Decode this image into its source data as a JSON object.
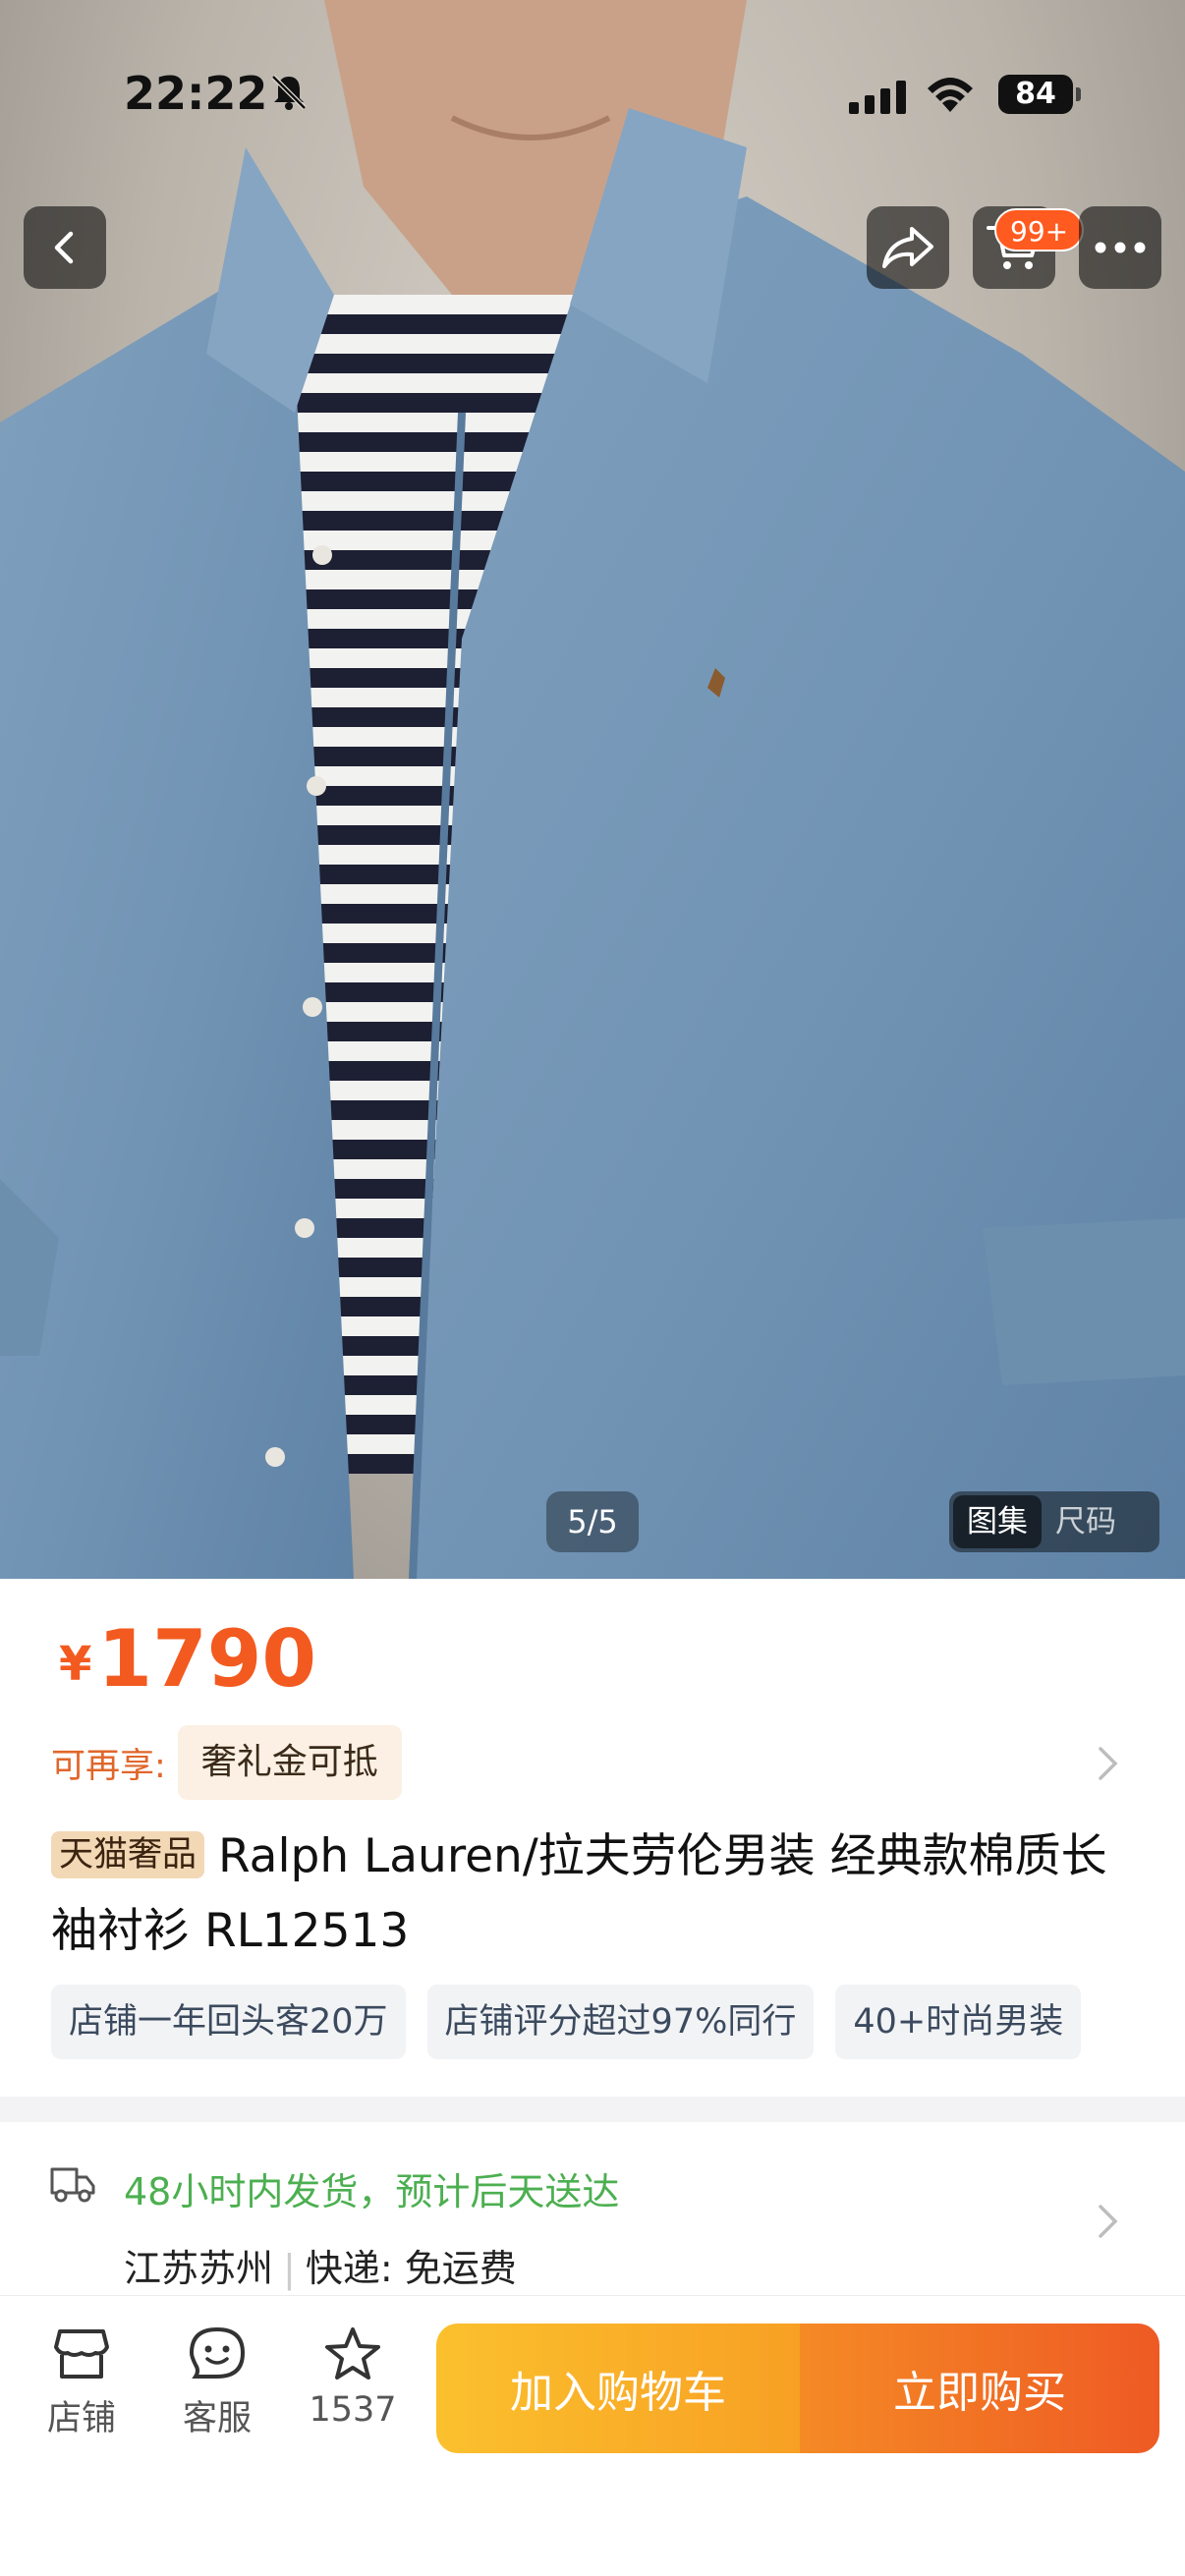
{
  "status_bar": {
    "time": "22:22",
    "battery": "84"
  },
  "nav": {
    "cart_badge": "99+"
  },
  "gallery": {
    "counter": "5/5",
    "tabs": [
      "图集",
      "尺码"
    ],
    "active_tab": "图集"
  },
  "product": {
    "currency": "¥",
    "price": "1790",
    "benefit_label": "可再享:",
    "benefit": "奢礼金可抵",
    "brand_tag": "天猫奢品",
    "title": "Ralph Lauren/拉夫劳伦男装 经典款棉质长袖衬衫 RL12513",
    "features": [
      "店铺一年回头客20万",
      "店铺评分超过97%同行",
      "40+时尚男装"
    ]
  },
  "shipping": {
    "promise": "48小时内发货，预计后天送达",
    "origin": "江苏苏州",
    "courier_label": "快递:",
    "courier_fee": "免运费"
  },
  "bottom_bar": {
    "store_label": "店铺",
    "service_label": "客服",
    "favorites_count": "1537",
    "add_to_cart": "加入购物车",
    "buy_now": "立即购买"
  },
  "colors": {
    "accent": "#f35a1f",
    "cart_button": "#f8a024",
    "buy_button": "#ee5a24",
    "shipping_text": "#4caf50"
  }
}
